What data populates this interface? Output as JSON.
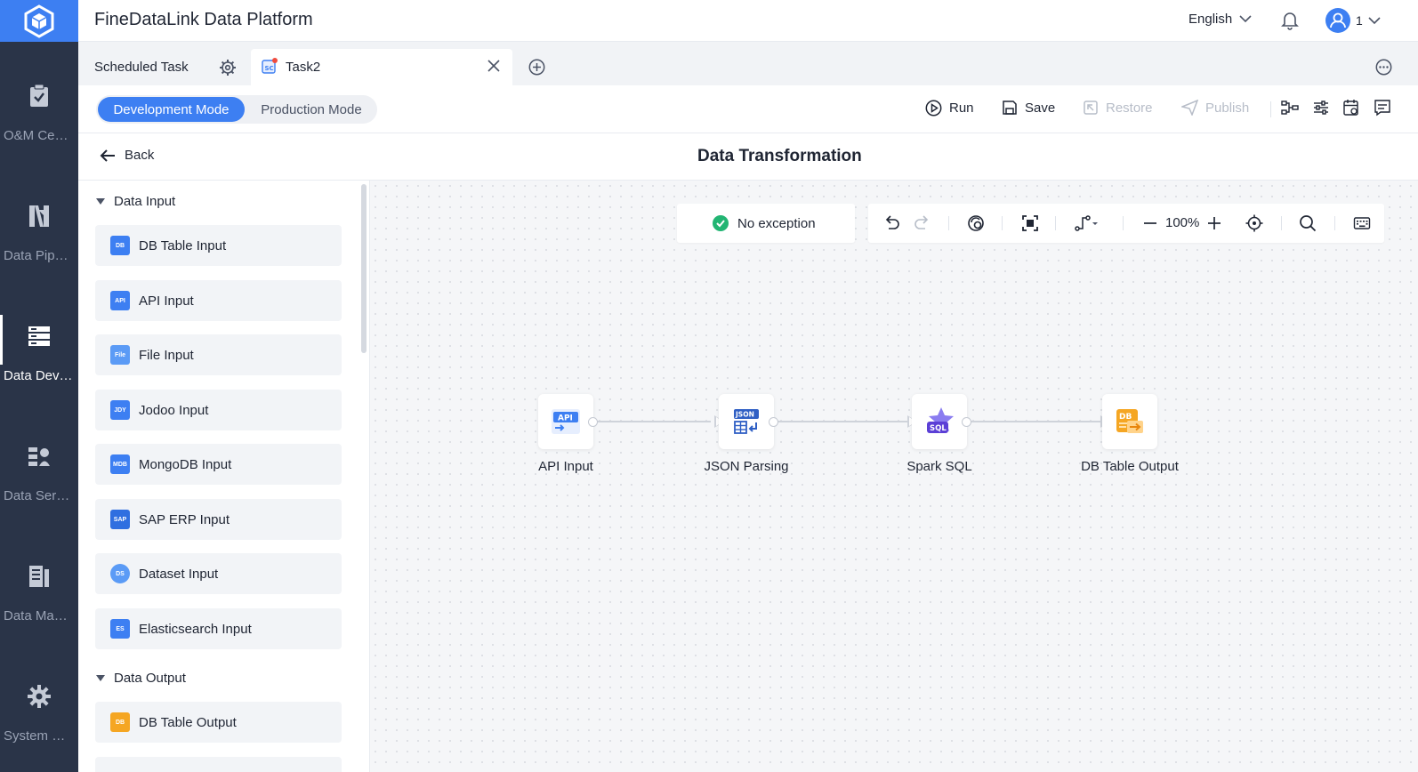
{
  "app": {
    "title": "FineDataLink Data Platform"
  },
  "header": {
    "language": "English",
    "user_count": "1"
  },
  "sidebar": {
    "items": [
      {
        "label": "O&M Center",
        "icon": "clipboard-check-icon"
      },
      {
        "label": "Data Pipeline",
        "icon": "pipeline-icon"
      },
      {
        "label": "Data Development",
        "icon": "database-stack-icon",
        "active": true
      },
      {
        "label": "Data Service",
        "icon": "data-service-icon"
      },
      {
        "label": "Data Management",
        "icon": "data-management-icon"
      },
      {
        "label": "System Management",
        "icon": "gear-icon"
      }
    ]
  },
  "tabs": [
    {
      "label": "Scheduled Task"
    },
    {
      "label": "Task2",
      "active": true
    }
  ],
  "mode": {
    "development": "Development Mode",
    "production": "Production Mode",
    "selected": "development"
  },
  "toolbar": {
    "run": "Run",
    "save": "Save",
    "restore": "Restore",
    "publish": "Publish"
  },
  "titlebar": {
    "back": "Back",
    "title": "Data Transformation"
  },
  "panel": {
    "groups": [
      {
        "title": "Data Input",
        "items": [
          {
            "label": "DB Table Input",
            "icon": "db-table-input-icon"
          },
          {
            "label": "API Input",
            "icon": "api-input-icon"
          },
          {
            "label": "File Input",
            "icon": "file-input-icon"
          },
          {
            "label": "Jodoo Input",
            "icon": "jodoo-input-icon"
          },
          {
            "label": "MongoDB Input",
            "icon": "mongodb-input-icon"
          },
          {
            "label": "SAP ERP Input",
            "icon": "sap-erp-input-icon"
          },
          {
            "label": "Dataset Input",
            "icon": "dataset-input-icon"
          },
          {
            "label": "Elasticsearch Input",
            "icon": "elasticsearch-input-icon"
          }
        ]
      },
      {
        "title": "Data Output",
        "items": [
          {
            "label": "DB Table Output",
            "icon": "db-table-output-icon"
          }
        ]
      }
    ]
  },
  "canvas": {
    "status": "No exception",
    "zoom": "100%",
    "nodes": [
      {
        "label": "API Input",
        "badge": "API"
      },
      {
        "label": "JSON Parsing",
        "badge": "JSON"
      },
      {
        "label": "Spark SQL",
        "badge": "SQL"
      },
      {
        "label": "DB Table Output",
        "badge": "DB"
      }
    ]
  },
  "colors": {
    "accent": "#3d7ff2",
    "sidebar": "#2a3448",
    "success": "#22b573",
    "output": "#f5a623"
  }
}
